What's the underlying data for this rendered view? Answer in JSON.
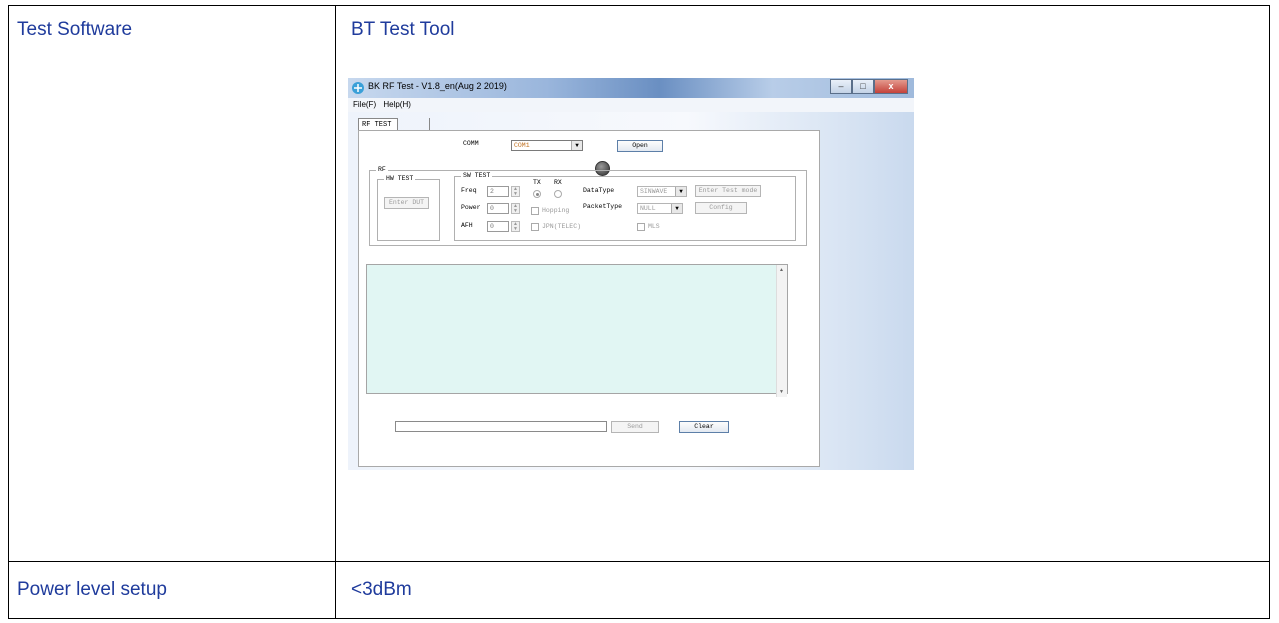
{
  "table": {
    "row1": {
      "label": "Test Software",
      "value": "BT Test Tool"
    },
    "row2": {
      "label": "Power level setup",
      "value": "<3dBm"
    }
  },
  "window": {
    "title": "BK RF Test - V1.8_en(Aug  2 2019)",
    "controls": {
      "minimize": "–",
      "maximize": "□",
      "close": "x"
    },
    "menu": [
      {
        "label": "File(F)"
      },
      {
        "label": "Help(H)"
      }
    ],
    "tabs": [
      {
        "label": "RF TEST"
      },
      {
        "label": ""
      }
    ],
    "comm": {
      "label": "COMM",
      "value": "COM1",
      "open_label": "Open"
    },
    "rf": {
      "group_label": "RF",
      "hw_test": {
        "group_label": "HW TEST",
        "enter_dut_label": "Enter DUT"
      },
      "sw_test": {
        "group_label": "SW TEST",
        "freq_label": "Freq",
        "freq_value": "2",
        "power_label": "Power",
        "power_value": "0",
        "afh_label": "AFH",
        "afh_value": "0",
        "tx_label": "TX",
        "rx_label": "RX",
        "hopping_label": "Hopping",
        "jpn_label": "JPN(TELEC)",
        "datatype_label": "DataType",
        "datatype_value": "SINWAVE",
        "packettype_label": "PacketType",
        "packettype_value": "NULL",
        "enter_test_mode_label": "Enter Test mode",
        "config_label": "Config",
        "mls_label": "MLS"
      }
    },
    "send_label": "Send",
    "clear_label": "Clear"
  }
}
